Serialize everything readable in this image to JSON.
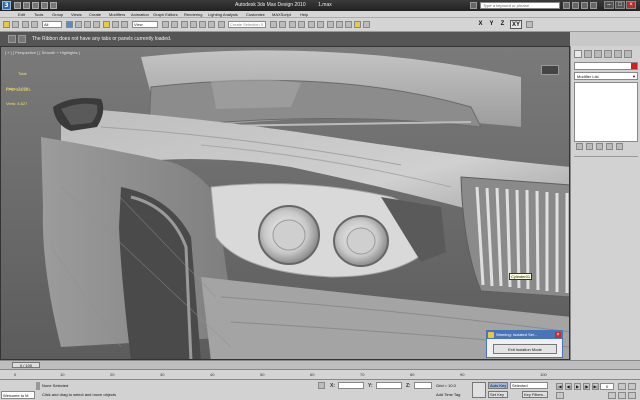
{
  "window": {
    "title": "Autodesk 3ds Max Design 2010",
    "file": "1.max",
    "search_placeholder": "Type a keyword or phrase"
  },
  "menu": [
    "Edit",
    "Tools",
    "Group",
    "Views",
    "Create",
    "Modifiers",
    "Animation",
    "Graph Editors",
    "Rendering",
    "Lighting Analysis",
    "Customize",
    "MAXScript",
    "Help"
  ],
  "toolbar": {
    "selection_filter": "All",
    "reference_coord": "View",
    "named_selection": "Create Selection S",
    "axes": [
      "X",
      "Y",
      "Z",
      "XY"
    ]
  },
  "ribbon": {
    "message": "The Ribbon does not have any tabs or panels currently loaded."
  },
  "viewport": {
    "label": "[ + ] [ Perspective ] [ Smooth + Highlights ]",
    "stats_header": "Total",
    "polys_label": "Polys:",
    "polys_value": "7,976",
    "verts_label": "Verts:",
    "verts_value": "8,627",
    "fps_label": "FPS:",
    "fps_value": "326.223",
    "object_tooltip": "Cylinder01"
  },
  "isolation_dialog": {
    "title": "Warning: Isolated Sel...",
    "button": "Exit Isolation Mode"
  },
  "command_panel": {
    "modifier_list": "Modifier List"
  },
  "timeline": {
    "slider": "0 / 100",
    "ticks": [
      "0",
      "10",
      "20",
      "30",
      "40",
      "50",
      "60",
      "70",
      "80",
      "90",
      "100"
    ]
  },
  "status": {
    "maxscript": "Welcome to M",
    "selection": "None Selected",
    "prompt": "Click and drag to select and move objects",
    "x_label": "X:",
    "y_label": "Y:",
    "z_label": "Z:",
    "grid": "Grid = 10.0",
    "add_time_tag": "Add Time Tag",
    "auto_key": "Auto Key",
    "set_key": "Set Key",
    "selected_dropdown": "Selected",
    "key_filters": "Key Filters...",
    "current_frame": "0"
  },
  "colors": {
    "ribbon_bg": "#555555",
    "viewport_bg": "#6d6d6d",
    "stats_text": "#f0e060",
    "dialog_accent": "#4a74b8"
  }
}
